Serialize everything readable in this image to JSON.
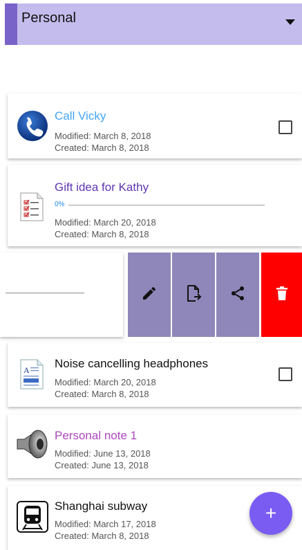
{
  "header": {
    "title": "Personal"
  },
  "notes": [
    {
      "title": "Call Vicky",
      "modified": "Modified: March 8, 2018",
      "created": "Created: March 8, 2018",
      "title_color": "#42a5f5"
    },
    {
      "title": "Gift idea for Kathy",
      "progress_label": "0%",
      "progress": 0,
      "modified": "Modified: March 20, 2018",
      "created": "Created: March 8, 2018",
      "title_color": "#5e35b1"
    },
    {
      "title": "Noise cancelling headphones",
      "modified": "Modified: March 20, 2018",
      "created": "Created: March 8, 2018",
      "title_color": "#111111"
    },
    {
      "title": "Personal note 1",
      "modified": "Modified: June 13, 2018",
      "created": "Created: June 13, 2018",
      "title_color": "#ab47bc"
    },
    {
      "title": "Shanghai subway",
      "modified": "Modified: March 17, 2018",
      "created": "Created: March 8, 2018",
      "title_color": "#111111"
    }
  ],
  "actions": {
    "edit": "edit-icon",
    "export": "export-icon",
    "share": "share-icon",
    "delete": "delete-icon"
  },
  "fab": {
    "label": "+"
  },
  "colors": {
    "header_bg": "#c4bcec",
    "accent": "#7a63c8",
    "action_bg": "#8f87b9",
    "delete_bg": "#ff0000",
    "fab": "#7b5cf2"
  }
}
